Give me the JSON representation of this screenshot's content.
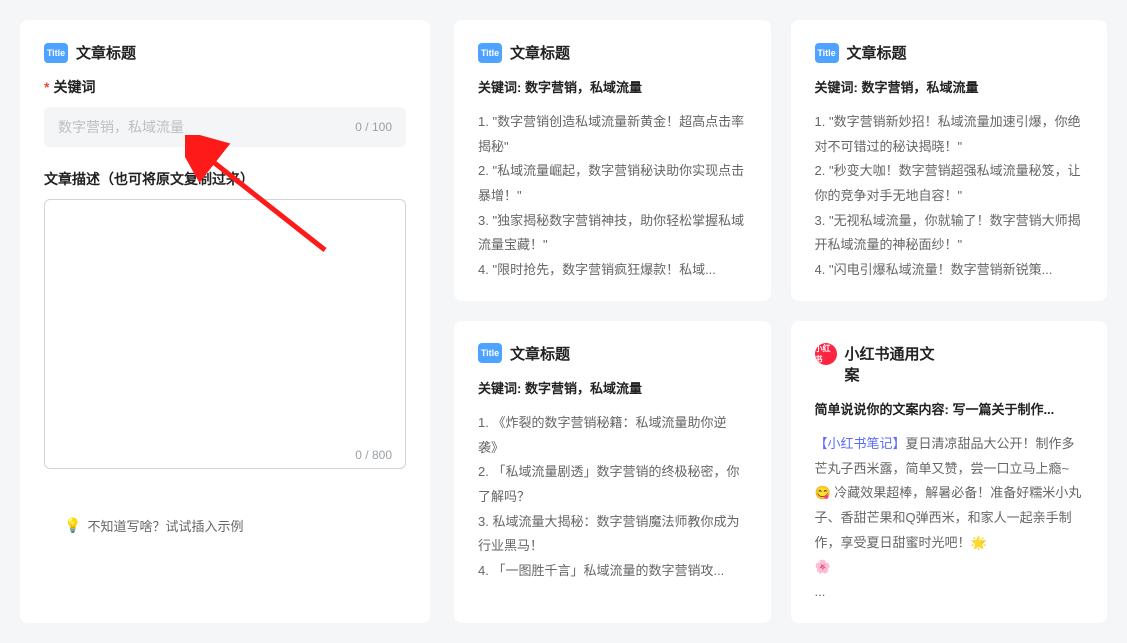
{
  "leftPanel": {
    "header": "文章标题",
    "keywordLabel": "关键词",
    "keywordRequiredMark": "*",
    "keywordPlaceholder": "数字营销，私域流量",
    "keywordCounter": "0 / 100",
    "descLabel": "文章描述（也可将原文复制过来）",
    "descCounter": "0 / 800",
    "exampleHint": "不知道写啥？试试插入示例"
  },
  "cards": [
    {
      "icon": "Title",
      "title": "文章标题",
      "subtitle": "关键词: 数字营销，私域流量",
      "body": "1. \"数字营销创造私域流量新黄金！超高点击率揭秘\"\n2. \"私域流量崛起，数字营销秘诀助你实现点击暴增！\"\n3. \"独家揭秘数字营销神技，助你轻松掌握私域流量宝藏！\"\n4. \"限时抢先，数字营销疯狂爆款！私域..."
    },
    {
      "icon": "Title",
      "title": "文章标题",
      "subtitle": "关键词: 数字营销，私域流量",
      "body": "1. \"数字营销新妙招！私域流量加速引爆，你绝对不可错过的秘诀揭晓！\"\n2. \"秒变大咖！数字营销超强私域流量秘笈，让你的竞争对手无地自容！\"\n3. \"无视私域流量，你就输了！数字营销大师揭开私域流量的神秘面纱！\"\n4. \"闪电引爆私域流量！数字营销新锐策..."
    },
    {
      "icon": "Title",
      "title": "文章标题",
      "subtitle": "关键词: 数字营销，私域流量",
      "body": "1. 《炸裂的数字营销秘籍：私域流量助你逆袭》\n2. 「私域流量剧透」数字营销的终极秘密，你了解吗？\n3. 私域流量大揭秘：数字营销魔法师教你成为行业黑马！\n4. 「一图胜千言」私域流量的数字营销攻..."
    }
  ],
  "xhsCard": {
    "iconText": "小红书",
    "title": "小红书通用文",
    "titleLine2": "案",
    "subtitle": "简单说说你的文案内容: 写一篇关于制作...",
    "bodyPrefixHighlight": "【小红书笔记】",
    "bodyPart1": "夏日清凉甜品大公开！制作多芒丸子西米露，简单又赞，尝一口立马上瘾~ ",
    "emoji1": "😋",
    "bodyPart2": " 冷藏效果超棒，解暑必备！准备好糯米小丸子、香甜芒果和Q弹西米，和家人一起亲手制作，享受夏日甜蜜时光吧！",
    "emoji2": "🌟",
    "emoji3": "🌸",
    "ellipsis": "..."
  }
}
